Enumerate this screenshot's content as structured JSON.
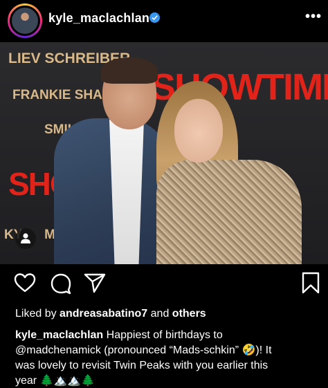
{
  "header": {
    "username": "kyle_maclachlan",
    "verified": true,
    "more_label": "•••"
  },
  "photo": {
    "backdrop_text": {
      "line1": "LIEV SCHREIBER",
      "line2": "FRANKIE SHA",
      "line3": "SMILF",
      "line4": "KY",
      "line5": "MA"
    },
    "logo_text": {
      "main": "SHOWTIME",
      "small": "SHOW"
    },
    "tag_icon": "person-icon"
  },
  "actions": {
    "like_icon": "heart-icon",
    "comment_icon": "comment-icon",
    "share_icon": "paper-plane-icon",
    "save_icon": "bookmark-icon"
  },
  "liked_by": {
    "prefix": "Liked by ",
    "user": "andreasabatino7",
    "middle": " and ",
    "others": "others"
  },
  "caption": {
    "author": "kyle_maclachlan",
    "line1": " Happiest of birthdays to",
    "line2": "@madchenamick (pronounced “Mads-schkin” 🤣)! It",
    "line3": "was lovely to revisit Twin Peaks with you earlier this",
    "line4": "year 🌲🏔️🏔️🌲"
  },
  "colors": {
    "background": "#000000",
    "verified": "#3897f0",
    "brand_red": "#e2231a",
    "wall_text": "#d9b98a"
  }
}
